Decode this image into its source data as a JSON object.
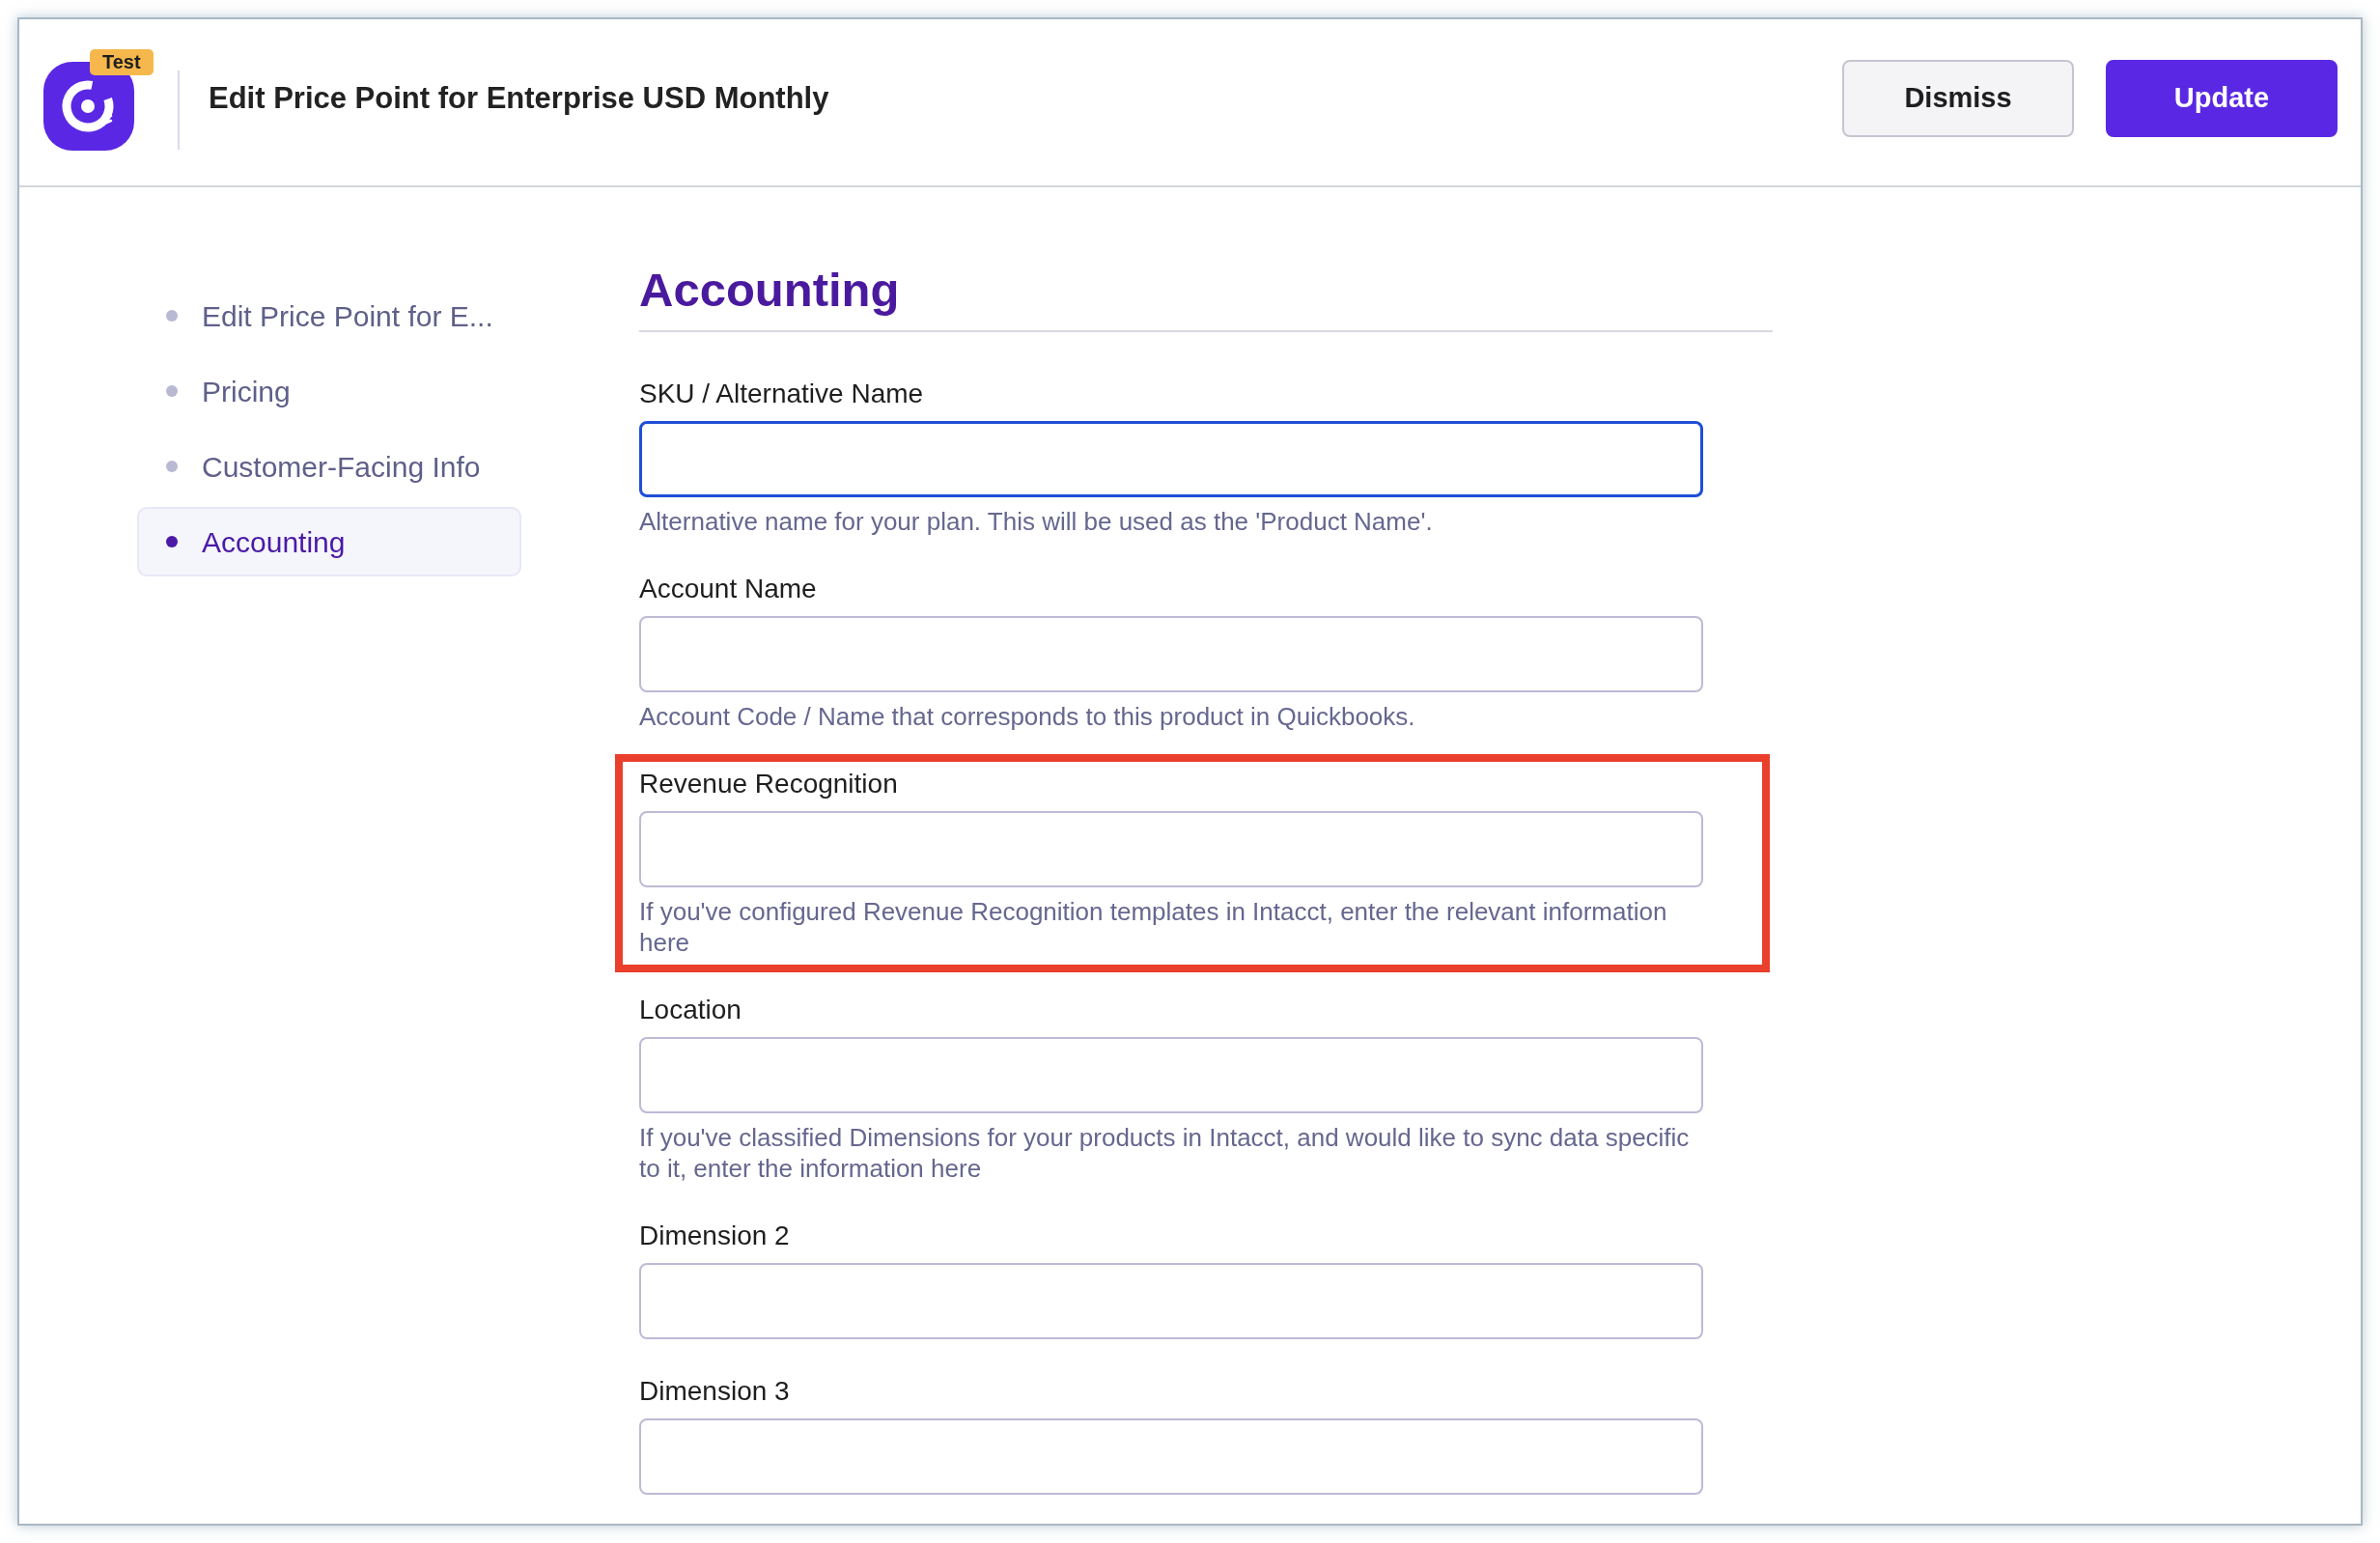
{
  "header": {
    "logo_badge": "Test",
    "title": "Edit Price Point for Enterprise USD Monthly",
    "buttons": [
      {
        "label": "Dismiss",
        "kind": "secondary"
      },
      {
        "label": "Update",
        "kind": "primary"
      }
    ]
  },
  "sidebar": {
    "items": [
      {
        "label": "Edit Price Point for E...",
        "selected": false
      },
      {
        "label": "Pricing",
        "selected": false
      },
      {
        "label": "Customer-Facing Info",
        "selected": false
      },
      {
        "label": "Accounting",
        "selected": true
      }
    ]
  },
  "section": {
    "heading": "Accounting",
    "fields": [
      {
        "label": "SKU / Alternative Name",
        "focused": true,
        "highlighted": false,
        "help": "Alternative name for your plan. This will be used as the 'Product Name'."
      },
      {
        "label": "Account Name",
        "focused": false,
        "highlighted": false,
        "help": "Account Code / Name that corresponds to this product in Quickbooks."
      },
      {
        "label": "Revenue Recognition",
        "focused": false,
        "highlighted": true,
        "help": "If you've configured Revenue Recognition templates in Intacct, enter the relevant information here"
      },
      {
        "label": "Location",
        "focused": false,
        "highlighted": false,
        "help": "If you've classified Dimensions for your products in Intacct, and would like to sync data specific to it, enter the information here"
      },
      {
        "label": "Dimension 2",
        "focused": false,
        "highlighted": false
      },
      {
        "label": "Dimension 3",
        "focused": false,
        "highlighted": false
      }
    ]
  }
}
